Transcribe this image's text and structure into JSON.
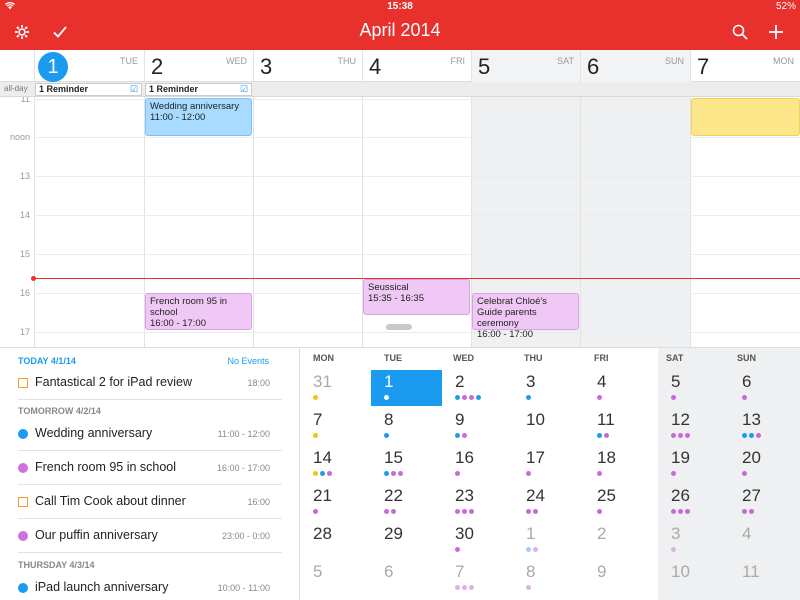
{
  "status": {
    "time": "15:38",
    "battery": "52%",
    "wifi_icon": "wifi-icon"
  },
  "nav": {
    "title": "April 2014",
    "settings_icon": "gear-icon",
    "check_icon": "checkmark-icon",
    "search_icon": "search-icon",
    "add_icon": "plus-icon"
  },
  "week": {
    "days": [
      {
        "num": "1",
        "dow": "TUE"
      },
      {
        "num": "2",
        "dow": "WED"
      },
      {
        "num": "3",
        "dow": "THU"
      },
      {
        "num": "4",
        "dow": "FRI"
      },
      {
        "num": "5",
        "dow": "SAT"
      },
      {
        "num": "6",
        "dow": "SUN"
      },
      {
        "num": "7",
        "dow": "MON"
      }
    ],
    "allday_label": "all-day",
    "reminders": [
      "1 Reminder",
      "1 Reminder"
    ]
  },
  "hours": [
    "11",
    "noon",
    "13",
    "14",
    "15",
    "16",
    "17"
  ],
  "events": [
    {
      "title": "Wedding anniversary",
      "time": "11:00 - 12:00"
    },
    {
      "title": "French room 95 in school",
      "time": "16:00 - 17:00"
    },
    {
      "title": "Seussical",
      "time": "15:35 - 16:35"
    },
    {
      "title": "Celebrat Chloé's Guide parents ceremony",
      "time": "16:00 - 17:00"
    }
  ],
  "agenda": {
    "today_header": "TODAY 4/1/14",
    "no_events": "No Events",
    "tomorrow_header": "TOMORROW 4/2/14",
    "thursday_header": "THURSDAY 4/3/14",
    "items": [
      {
        "title": "Fantastical 2 for iPad review",
        "time": "18:00"
      },
      {
        "title": "Wedding anniversary",
        "time": "11:00 - 12:00"
      },
      {
        "title": "French room 95 in school",
        "time": "16:00 - 17:00"
      },
      {
        "title": "Call Tim Cook about dinner",
        "time": "16:00"
      },
      {
        "title": "Our puffin anniversary",
        "time": "23:00 - 0:00"
      },
      {
        "title": "iPad launch anniversary",
        "time": "10:00 - 11:00"
      }
    ]
  },
  "month": {
    "headers": [
      "MON",
      "TUE",
      "WED",
      "THU",
      "FRI",
      "SAT",
      "SUN"
    ],
    "weeks": [
      [
        "31",
        "1",
        "2",
        "3",
        "4",
        "5",
        "6"
      ],
      [
        "7",
        "8",
        "9",
        "10",
        "11",
        "12",
        "13"
      ],
      [
        "14",
        "15",
        "16",
        "17",
        "18",
        "19",
        "20"
      ],
      [
        "21",
        "22",
        "23",
        "24",
        "25",
        "26",
        "27"
      ],
      [
        "28",
        "29",
        "30",
        "1",
        "2",
        "3",
        "4"
      ],
      [
        "5",
        "6",
        "7",
        "8",
        "9",
        "10",
        "11"
      ]
    ]
  },
  "colors": {
    "accent": "#e8302c",
    "today_blue": "#1a9bf0",
    "event_blue": "#a8dbff",
    "event_purple": "#f0c8f5",
    "event_yellow": "#fde58a",
    "reminder_orange": "#f39c2a"
  }
}
